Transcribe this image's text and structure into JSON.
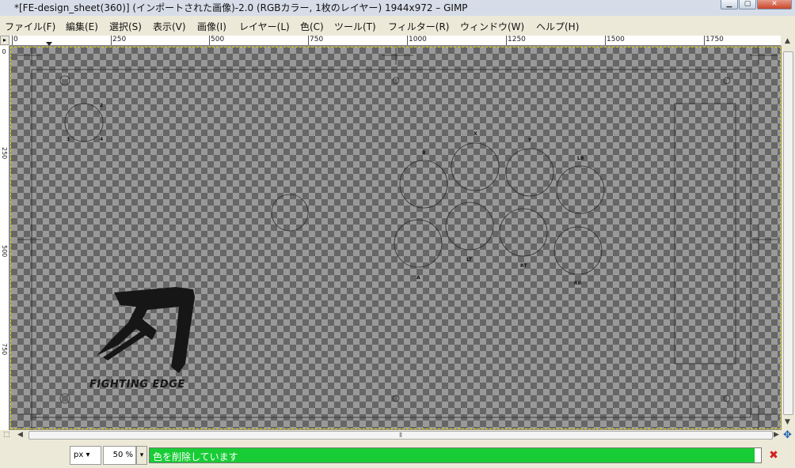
{
  "window": {
    "title": "*[FE-design_sheet(360)] (インポートされた画像)-2.0 (RGBカラー, 1枚のレイヤー) 1944x972 – GIMP"
  },
  "menu": [
    "ファイル(F)",
    "編集(E)",
    "選択(S)",
    "表示(V)",
    "画像(I)",
    "レイヤー(L)",
    "色(C)",
    "ツール(T)",
    "フィルター(R)",
    "ウィンドウ(W)",
    "ヘルプ(H)"
  ],
  "ruler": {
    "h_labels": [
      "0",
      "250",
      "500",
      "750",
      "1000",
      "1250",
      "1500",
      "1750"
    ],
    "v_labels": [
      "0",
      "250",
      "500",
      "750"
    ]
  },
  "canvas": {
    "button_labels": [
      "B",
      "X",
      "Y",
      "LB",
      "A",
      "LT",
      "RT",
      "RB"
    ],
    "small_marks": [
      "2",
      "3",
      "4"
    ],
    "logo_text": "FIGHTING EDGE"
  },
  "statusbar": {
    "unit": "px",
    "zoom": "50 %",
    "progress_text": "色を削除しています",
    "progress": 0.99
  },
  "colors": {
    "progress": "#18cc35",
    "layer_border": "#e2d800",
    "cancel": "#d02020"
  },
  "icons": {
    "cancel": "close-icon",
    "navigate": "navigate-icon",
    "quick_mask": "quick-mask-icon"
  }
}
